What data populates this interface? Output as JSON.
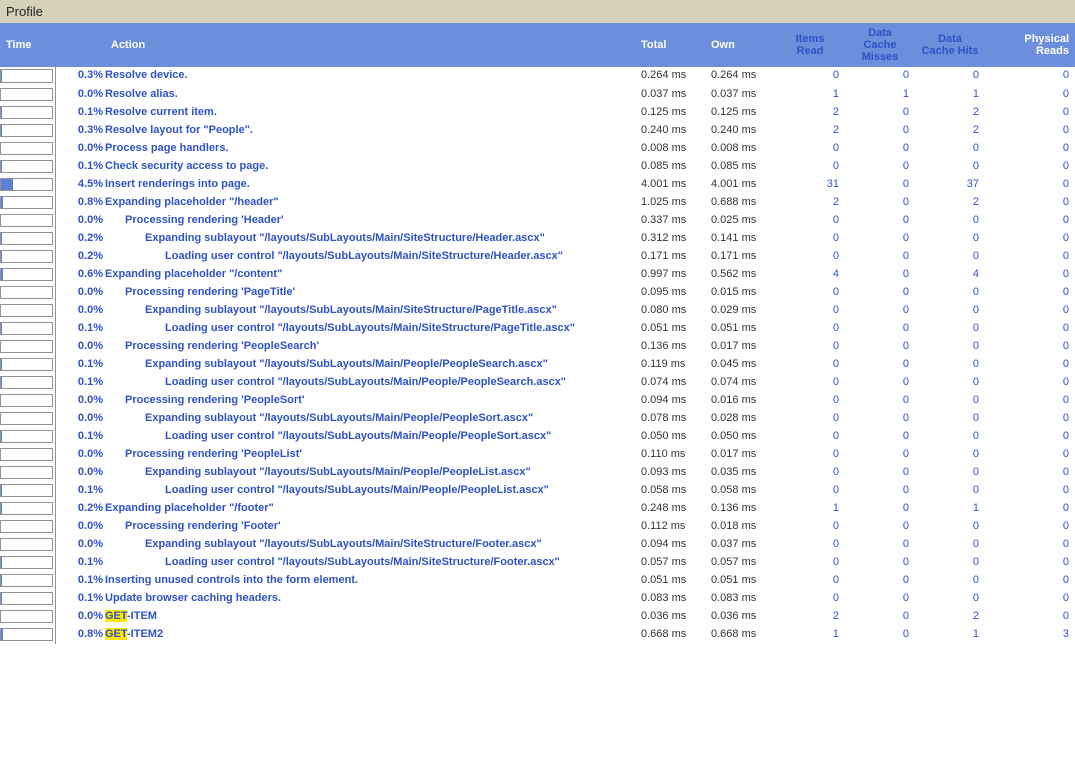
{
  "title": "Profile",
  "columns": {
    "time": "Time",
    "action": "Action",
    "total": "Total",
    "own": "Own",
    "itemsRead": "Items Read",
    "cacheMisses": "Data Cache Misses",
    "cacheHits": "Data Cache Hits",
    "physReads": "Physical Reads"
  },
  "rows": [
    {
      "pct": "0.3%",
      "action": "Resolve device.",
      "indent": 0,
      "total": "0.264 ms",
      "own": "0.264 ms",
      "ir": 0,
      "cm": 0,
      "ch": 0,
      "pr": 0,
      "bar": 2
    },
    {
      "pct": "0.0%",
      "action": "Resolve alias.",
      "indent": 0,
      "total": "0.037 ms",
      "own": "0.037 ms",
      "ir": 1,
      "cm": 1,
      "ch": 1,
      "pr": 0,
      "bar": 0
    },
    {
      "pct": "0.1%",
      "action": "Resolve current item.",
      "indent": 0,
      "total": "0.125 ms",
      "own": "0.125 ms",
      "ir": 2,
      "cm": 0,
      "ch": 2,
      "pr": 0,
      "bar": 1
    },
    {
      "pct": "0.3%",
      "action": "Resolve layout for \"People\".",
      "indent": 0,
      "total": "0.240 ms",
      "own": "0.240 ms",
      "ir": 2,
      "cm": 0,
      "ch": 2,
      "pr": 0,
      "bar": 2
    },
    {
      "pct": "0.0%",
      "action": "Process page handlers.",
      "indent": 0,
      "total": "0.008 ms",
      "own": "0.008 ms",
      "ir": 0,
      "cm": 0,
      "ch": 0,
      "pr": 0,
      "bar": 0
    },
    {
      "pct": "0.1%",
      "action": "Check security access to page.",
      "indent": 0,
      "total": "0.085 ms",
      "own": "0.085 ms",
      "ir": 0,
      "cm": 0,
      "ch": 0,
      "pr": 0,
      "bar": 1
    },
    {
      "pct": "4.5%",
      "action": "Insert renderings into page.",
      "indent": 0,
      "total": "4.001 ms",
      "own": "4.001 ms",
      "ir": 31,
      "cm": 0,
      "ch": 37,
      "pr": 0,
      "bar": 24
    },
    {
      "pct": "0.8%",
      "action": "Expanding placeholder \"/header\"",
      "indent": 0,
      "total": "1.025 ms",
      "own": "0.688 ms",
      "ir": 2,
      "cm": 0,
      "ch": 2,
      "pr": 0,
      "bar": 4
    },
    {
      "pct": "0.0%",
      "action": "Processing rendering 'Header'",
      "indent": 1,
      "total": "0.337 ms",
      "own": "0.025 ms",
      "ir": 0,
      "cm": 0,
      "ch": 0,
      "pr": 0,
      "bar": 0
    },
    {
      "pct": "0.2%",
      "action": "Expanding sublayout \"/layouts/SubLayouts/Main/SiteStructure/Header.ascx\"",
      "indent": 2,
      "total": "0.312 ms",
      "own": "0.141 ms",
      "ir": 0,
      "cm": 0,
      "ch": 0,
      "pr": 0,
      "bar": 1
    },
    {
      "pct": "0.2%",
      "action": "Loading user control \"/layouts/SubLayouts/Main/SiteStructure/Header.ascx\"",
      "indent": 3,
      "total": "0.171 ms",
      "own": "0.171 ms",
      "ir": 0,
      "cm": 0,
      "ch": 0,
      "pr": 0,
      "bar": 1
    },
    {
      "pct": "0.6%",
      "action": "Expanding placeholder \"/content\"",
      "indent": 0,
      "total": "0.997 ms",
      "own": "0.562 ms",
      "ir": 4,
      "cm": 0,
      "ch": 4,
      "pr": 0,
      "bar": 3
    },
    {
      "pct": "0.0%",
      "action": "Processing rendering 'PageTitle'",
      "indent": 1,
      "total": "0.095 ms",
      "own": "0.015 ms",
      "ir": 0,
      "cm": 0,
      "ch": 0,
      "pr": 0,
      "bar": 0
    },
    {
      "pct": "0.0%",
      "action": "Expanding sublayout \"/layouts/SubLayouts/Main/SiteStructure/PageTitle.ascx\"",
      "indent": 2,
      "total": "0.080 ms",
      "own": "0.029 ms",
      "ir": 0,
      "cm": 0,
      "ch": 0,
      "pr": 0,
      "bar": 0
    },
    {
      "pct": "0.1%",
      "action": "Loading user control \"/layouts/SubLayouts/Main/SiteStructure/PageTitle.ascx\"",
      "indent": 3,
      "total": "0.051 ms",
      "own": "0.051 ms",
      "ir": 0,
      "cm": 0,
      "ch": 0,
      "pr": 0,
      "bar": 1
    },
    {
      "pct": "0.0%",
      "action": "Processing rendering 'PeopleSearch'",
      "indent": 1,
      "total": "0.136 ms",
      "own": "0.017 ms",
      "ir": 0,
      "cm": 0,
      "ch": 0,
      "pr": 0,
      "bar": 0
    },
    {
      "pct": "0.1%",
      "action": "Expanding sublayout \"/layouts/SubLayouts/Main/People/PeopleSearch.ascx\"",
      "indent": 2,
      "total": "0.119 ms",
      "own": "0.045 ms",
      "ir": 0,
      "cm": 0,
      "ch": 0,
      "pr": 0,
      "bar": 1
    },
    {
      "pct": "0.1%",
      "action": "Loading user control \"/layouts/SubLayouts/Main/People/PeopleSearch.ascx\"",
      "indent": 3,
      "total": "0.074 ms",
      "own": "0.074 ms",
      "ir": 0,
      "cm": 0,
      "ch": 0,
      "pr": 0,
      "bar": 1
    },
    {
      "pct": "0.0%",
      "action": "Processing rendering 'PeopleSort'",
      "indent": 1,
      "total": "0.094 ms",
      "own": "0.016 ms",
      "ir": 0,
      "cm": 0,
      "ch": 0,
      "pr": 0,
      "bar": 0
    },
    {
      "pct": "0.0%",
      "action": "Expanding sublayout \"/layouts/SubLayouts/Main/People/PeopleSort.ascx\"",
      "indent": 2,
      "total": "0.078 ms",
      "own": "0.028 ms",
      "ir": 0,
      "cm": 0,
      "ch": 0,
      "pr": 0,
      "bar": 0
    },
    {
      "pct": "0.1%",
      "action": "Loading user control \"/layouts/SubLayouts/Main/People/PeopleSort.ascx\"",
      "indent": 3,
      "total": "0.050 ms",
      "own": "0.050 ms",
      "ir": 0,
      "cm": 0,
      "ch": 0,
      "pr": 0,
      "bar": 1
    },
    {
      "pct": "0.0%",
      "action": "Processing rendering 'PeopleList'",
      "indent": 1,
      "total": "0.110 ms",
      "own": "0.017 ms",
      "ir": 0,
      "cm": 0,
      "ch": 0,
      "pr": 0,
      "bar": 0
    },
    {
      "pct": "0.0%",
      "action": "Expanding sublayout \"/layouts/SubLayouts/Main/People/PeopleList.ascx\"",
      "indent": 2,
      "total": "0.093 ms",
      "own": "0.035 ms",
      "ir": 0,
      "cm": 0,
      "ch": 0,
      "pr": 0,
      "bar": 0
    },
    {
      "pct": "0.1%",
      "action": "Loading user control \"/layouts/SubLayouts/Main/People/PeopleList.ascx\"",
      "indent": 3,
      "total": "0.058 ms",
      "own": "0.058 ms",
      "ir": 0,
      "cm": 0,
      "ch": 0,
      "pr": 0,
      "bar": 1
    },
    {
      "pct": "0.2%",
      "action": "Expanding placeholder \"/footer\"",
      "indent": 0,
      "total": "0.248 ms",
      "own": "0.136 ms",
      "ir": 1,
      "cm": 0,
      "ch": 1,
      "pr": 0,
      "bar": 1
    },
    {
      "pct": "0.0%",
      "action": "Processing rendering 'Footer'",
      "indent": 1,
      "total": "0.112 ms",
      "own": "0.018 ms",
      "ir": 0,
      "cm": 0,
      "ch": 0,
      "pr": 0,
      "bar": 0
    },
    {
      "pct": "0.0%",
      "action": "Expanding sublayout \"/layouts/SubLayouts/Main/SiteStructure/Footer.ascx\"",
      "indent": 2,
      "total": "0.094 ms",
      "own": "0.037 ms",
      "ir": 0,
      "cm": 0,
      "ch": 0,
      "pr": 0,
      "bar": 0
    },
    {
      "pct": "0.1%",
      "action": "Loading user control \"/layouts/SubLayouts/Main/SiteStructure/Footer.ascx\"",
      "indent": 3,
      "total": "0.057 ms",
      "own": "0.057 ms",
      "ir": 0,
      "cm": 0,
      "ch": 0,
      "pr": 0,
      "bar": 1
    },
    {
      "pct": "0.1%",
      "action": "Inserting unused controls into the form element.",
      "indent": 0,
      "total": "0.051 ms",
      "own": "0.051 ms",
      "ir": 0,
      "cm": 0,
      "ch": 0,
      "pr": 0,
      "bar": 1
    },
    {
      "pct": "0.1%",
      "action": "Update browser caching headers.",
      "indent": 0,
      "total": "0.083 ms",
      "own": "0.083 ms",
      "ir": 0,
      "cm": 0,
      "ch": 0,
      "pr": 0,
      "bar": 1
    },
    {
      "pct": "0.0%",
      "hl": "GET",
      "action": "-ITEM",
      "indent": 0,
      "total": "0.036 ms",
      "own": "0.036 ms",
      "ir": 2,
      "cm": 0,
      "ch": 2,
      "pr": 0,
      "bar": 0
    },
    {
      "pct": "0.8%",
      "hl": "GET",
      "action": "-ITEM2",
      "indent": 0,
      "total": "0.668 ms",
      "own": "0.668 ms",
      "ir": 1,
      "cm": 0,
      "ch": 1,
      "pr": 3,
      "bar": 4
    }
  ]
}
